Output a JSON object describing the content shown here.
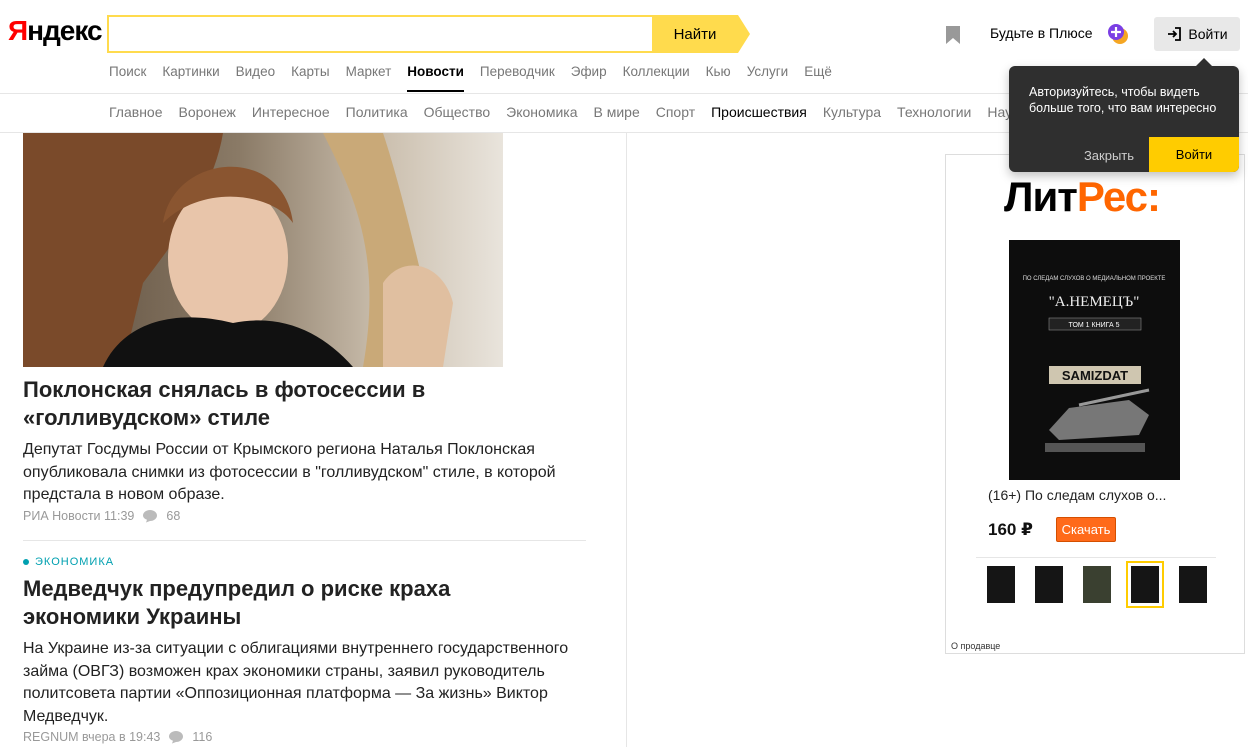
{
  "header": {
    "logo_first": "Я",
    "logo_rest": "ндекс",
    "search_button": "Найти",
    "search_value": "",
    "plus_link": "Будьте в Плюсе",
    "login_button": "Войти",
    "services": [
      "Поиск",
      "Картинки",
      "Видео",
      "Карты",
      "Маркет",
      "Новости",
      "Переводчик",
      "Эфир",
      "Коллекции",
      "Кью",
      "Услуги",
      "Ещё"
    ],
    "active_service": "Новости"
  },
  "rubrics": [
    "Главное",
    "Воронеж",
    "Интересное",
    "Политика",
    "Общество",
    "Экономика",
    "В мире",
    "Спорт",
    "Происшествия",
    "Культура",
    "Технологии",
    "Наука"
  ],
  "stories": [
    {
      "title": "Поклонская снялась в фотосессии в «голливудском» стиле",
      "text": "Депутат Госдумы России от Крымского региона Наталья Поклонская опубликовала снимки из фотосессии в \"голливудском\" стиле, в которой предстала в новом образе.",
      "source": "РИА Новости",
      "time": "11:39",
      "comments": "68"
    },
    {
      "tag": "ЭКОНОМИКА",
      "title": "Медведчук предупредил о риске краха экономики Украины",
      "text": "На Украине из-за ситуации с облигациями внутреннего государственного займа (ОВГЗ) возможен крах экономики страны, заявил руководитель политсовета партии «Оппозиционная платформа — За жизнь» Виктор Медведчук.",
      "source": "REGNUM",
      "time": "вчера в 19:43",
      "comments": "116"
    }
  ],
  "ad": {
    "logo_first": "Лит",
    "logo_rest": "Рес:",
    "book_title": "(16+) По следам слухов о...",
    "price": "160 ₽",
    "buy_button": "Скачать",
    "seller_link": "О продавце",
    "cover_lines": [
      "ПО СЛЕДАМ СЛУХОВ О МЕДИАЛЬНОМ ПРОЕКТЕ",
      "\"А.НЕМЕЦЪ\"",
      "ТОМ 1  КНИГА 5",
      "SAMIZDAT"
    ]
  },
  "popup": {
    "text": "Авторизуйтесь, чтобы видеть больше того, что вам интересно",
    "close": "Закрыть",
    "login": "Войти"
  },
  "colors": {
    "search_yellow": "#ffdb4d",
    "tag_teal": "#00a0b0",
    "litres_orange": "#ff6a1a",
    "popup_bg": "#2f2f2f"
  }
}
